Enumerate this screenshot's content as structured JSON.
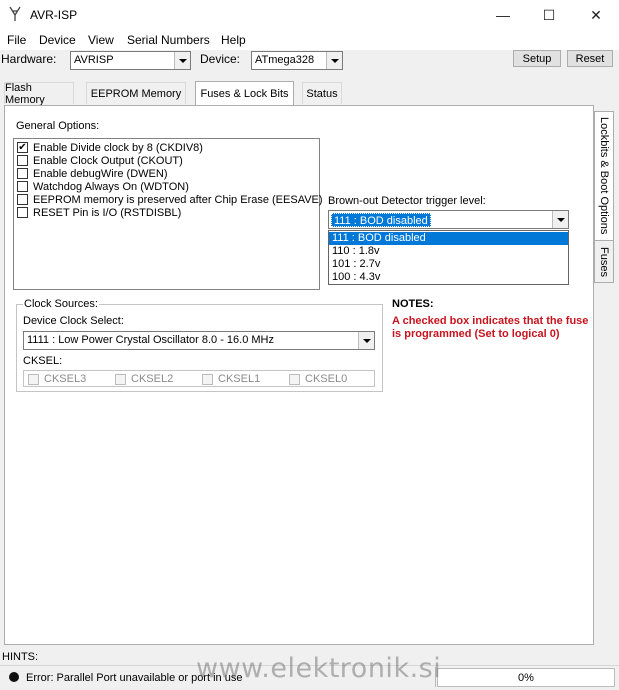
{
  "window": {
    "title": "AVR-ISP",
    "minimize": "—",
    "maximize": "☐",
    "close": "✕"
  },
  "menu": [
    "File",
    "Device",
    "View",
    "Serial Numbers",
    "Help"
  ],
  "toolbar": {
    "hardware_label": "Hardware:",
    "hardware_value": "AVRISP",
    "device_label": "Device:",
    "device_value": "ATmega328",
    "setup_label": "Setup",
    "reset_label": "Reset"
  },
  "tabs": [
    "Flash Memory",
    "EEPROM Memory",
    "Fuses & Lock Bits",
    "Status"
  ],
  "active_tab": "Fuses & Lock Bits",
  "general": {
    "title": "General Options:",
    "options": [
      {
        "label": "Enable Divide clock by 8 (CKDIV8)",
        "checked": true
      },
      {
        "label": "Enable Clock Output (CKOUT)",
        "checked": false
      },
      {
        "label": "Enable debugWire (DWEN)",
        "checked": false
      },
      {
        "label": "Watchdog Always On (WDTON)",
        "checked": false
      },
      {
        "label": "EEPROM memory is preserved after Chip Erase (EESAVE)",
        "checked": false
      },
      {
        "label": "RESET Pin is I/O (RSTDISBL)",
        "checked": false
      }
    ]
  },
  "bod": {
    "label": "Brown-out Detector trigger level:",
    "selected": "111 : BOD disabled",
    "options": [
      "111 : BOD disabled",
      "110 : 1.8v",
      "101 : 2.7v",
      "100 : 4.3v"
    ]
  },
  "clock": {
    "group_title": "Clock Sources:",
    "select_label": "Device Clock Select:",
    "select_value": "1111 : Low Power Crystal Oscillator 8.0 - 16.0 MHz",
    "cksel_label": "CKSEL:",
    "cksel": [
      "CKSEL3",
      "CKSEL2",
      "CKSEL1",
      "CKSEL0"
    ]
  },
  "notes": {
    "title": "NOTES:",
    "text": "A checked box indicates that the fuse is programmed (Set to logical 0)",
    "color": "#c8141e"
  },
  "side_tabs": [
    "Lockbits & Boot Options",
    "Fuses"
  ],
  "hints_label": "HINTS:",
  "status": {
    "text": "Error: Parallel Port unavailable or port in use",
    "progress": "0%"
  },
  "watermark": "www.elektronik.si"
}
